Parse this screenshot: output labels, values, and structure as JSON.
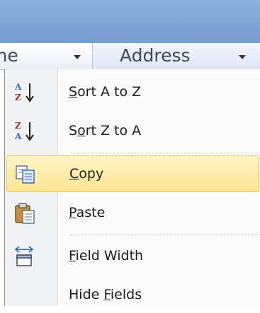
{
  "columns": {
    "name_header": "me",
    "address_header": "Address"
  },
  "menu": {
    "items": [
      {
        "pre": "",
        "accel": "S",
        "post": "ort A to Z",
        "icon": "sort-ascending-icon"
      },
      {
        "pre": "S",
        "accel": "o",
        "post": "rt Z to A",
        "icon": "sort-descending-icon"
      },
      {
        "pre": "",
        "accel": "C",
        "post": "opy",
        "icon": "copy-icon"
      },
      {
        "pre": "",
        "accel": "P",
        "post": "aste",
        "icon": "paste-icon"
      },
      {
        "pre": "",
        "accel": "F",
        "post": "ield Width",
        "icon": "field-width-icon"
      },
      {
        "pre": "Hide ",
        "accel": "F",
        "post": "ields",
        "icon": ""
      }
    ]
  },
  "colors": {
    "highlight": "#ffe592",
    "titlebar": "#7fa3d6"
  }
}
